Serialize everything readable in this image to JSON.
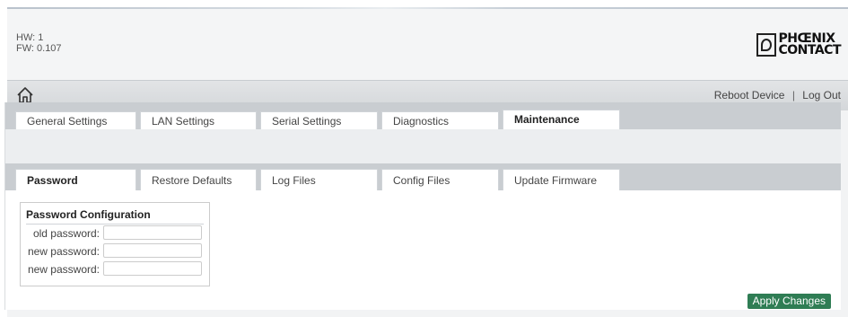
{
  "header": {
    "hw": "HW: 1",
    "fw": "FW: 0.107",
    "logo_top": "PHŒNIX",
    "logo_bottom": "CONTACT"
  },
  "nav": {
    "home_icon": "home-icon",
    "reboot_label": "Reboot Device",
    "separator": "|",
    "logout_label": "Log Out"
  },
  "main_tabs": [
    {
      "label": "General Settings",
      "active": false
    },
    {
      "label": "LAN Settings",
      "active": false
    },
    {
      "label": "Serial Settings",
      "active": false
    },
    {
      "label": "Diagnostics",
      "active": false
    },
    {
      "label": "Maintenance",
      "active": true
    }
  ],
  "sub_tabs": [
    {
      "label": "Password",
      "active": true
    },
    {
      "label": "Restore Defaults",
      "active": false
    },
    {
      "label": "Log Files",
      "active": false
    },
    {
      "label": "Config Files",
      "active": false
    },
    {
      "label": "Update Firmware",
      "active": false
    }
  ],
  "password_panel": {
    "title": "Password Configuration",
    "old_label": "old password:",
    "old_value": "",
    "new_label": "new password:",
    "new_value": "",
    "confirm_label": "new password:",
    "confirm_value": ""
  },
  "actions": {
    "apply_label": "Apply Changes"
  },
  "colors": {
    "apply_button": "#2f7d54",
    "tab_bar": "#c9cdd1",
    "navbar": "#d4d7da"
  }
}
